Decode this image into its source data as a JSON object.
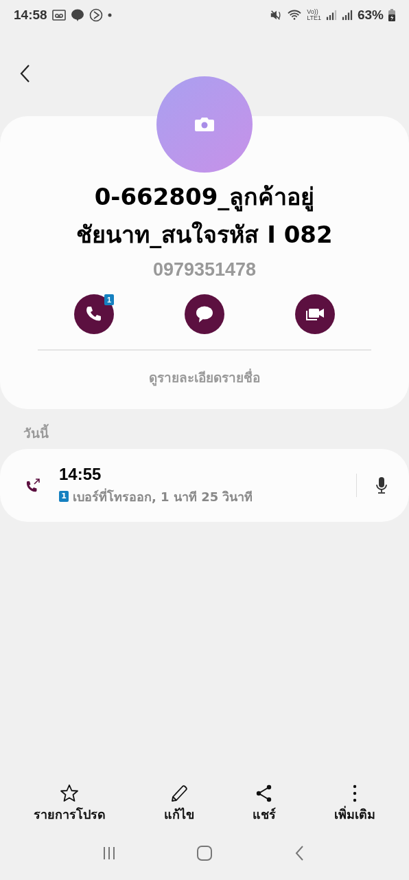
{
  "status_bar": {
    "time": "14:58",
    "volte": "Vo))",
    "network": "LTE1",
    "battery": "63%"
  },
  "contact": {
    "name_lines": [
      "0-662809_ลูกค้าอยู่",
      "ชัยนาท_สนใจรหัส I 082"
    ],
    "phone": "0979351478",
    "actions": [
      {
        "kind": "call",
        "badge": "1"
      },
      {
        "kind": "message"
      },
      {
        "kind": "video"
      }
    ],
    "details_link": "ดูรายละเอียดรายชื่อ"
  },
  "history": {
    "heading": "วันนี้",
    "entries": [
      {
        "time": "14:55",
        "sim": "1",
        "description": "เบอร์ที่โทรออก, 1 นาที 25 วินาที"
      }
    ]
  },
  "bottom_actions": [
    {
      "kind": "favorite",
      "label": "รายการโปรด"
    },
    {
      "kind": "edit",
      "label": "แก้ไข"
    },
    {
      "kind": "share",
      "label": "แชร์"
    },
    {
      "kind": "more",
      "label": "เพิ่มเติม"
    }
  ]
}
